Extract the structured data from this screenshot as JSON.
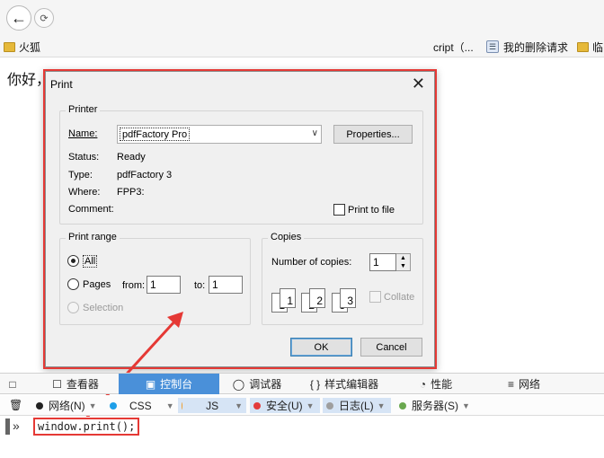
{
  "browser": {
    "reload_glyph": "⟳",
    "bookmarks": [
      {
        "label": "火狐"
      },
      {
        "label": "cript（..."
      },
      {
        "label": "我的删除请求"
      },
      {
        "label": "临"
      }
    ],
    "page_text": "你好，"
  },
  "print_dialog": {
    "title": "Print",
    "close_glyph": "✕",
    "printer": {
      "group_title": "Printer",
      "name_label": "Name:",
      "name_value": "pdfFactory Pro",
      "properties_button": "Properties...",
      "status_label": "Status:",
      "status_value": "Ready",
      "type_label": "Type:",
      "type_value": "pdfFactory 3",
      "where_label": "Where:",
      "where_value": "FPP3:",
      "comment_label": "Comment:",
      "comment_value": "",
      "print_to_file_label": "Print to file",
      "print_to_file_checked": false
    },
    "print_range": {
      "group_title": "Print range",
      "all_label": "All",
      "pages_label": "Pages",
      "from_label": "from:",
      "from_value": "1",
      "to_label": "to:",
      "to_value": "1",
      "selection_label": "Selection",
      "selected": "All"
    },
    "copies": {
      "group_title": "Copies",
      "number_label": "Number of copies:",
      "number_value": "1",
      "collate_label": "Collate",
      "collate_checked": false,
      "collate_pages": [
        "1",
        "1",
        "2",
        "2",
        "3",
        "3"
      ]
    },
    "ok_button": "OK",
    "cancel_button": "Cancel"
  },
  "devtools": {
    "tabs": [
      {
        "label": "查看器",
        "icon": "inspector-icon"
      },
      {
        "label": "控制台",
        "icon": "console-icon",
        "active": true
      },
      {
        "label": "调试器",
        "icon": "debugger-icon"
      },
      {
        "label": "样式编辑器",
        "icon": "style-editor-icon"
      },
      {
        "label": "性能",
        "icon": "performance-icon"
      },
      {
        "label": "网络",
        "icon": "network-icon"
      }
    ],
    "filters": [
      {
        "label": "网络(N)",
        "color": "#222222"
      },
      {
        "label": "CSS",
        "color": "#1e9fe8"
      },
      {
        "label": "JS",
        "color": "#f0a030"
      },
      {
        "label": "安全(U)",
        "color": "#e33b3b"
      },
      {
        "label": "日志(L)",
        "color": "#9e9e9e"
      },
      {
        "label": "服务器(S)",
        "color": "#6aa84f"
      }
    ],
    "prompt": "»",
    "command": "window.print();"
  },
  "colors": {
    "annotation_red": "#e53935",
    "active_tab": "#4a90d9"
  }
}
